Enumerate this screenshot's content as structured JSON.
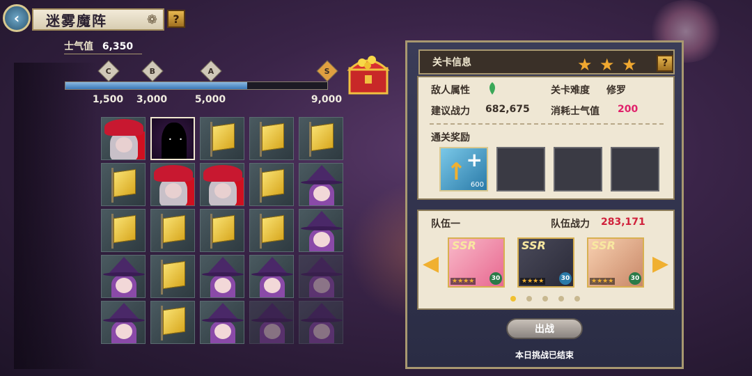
{
  "header": {
    "back_icon": "‹",
    "title": "迷雾魔阵",
    "title_deco": "❁",
    "help": "?"
  },
  "morale": {
    "label": "士气值",
    "value": "6,350",
    "progress_fraction": 0.6944
  },
  "grades": [
    "C",
    "B",
    "A",
    "S"
  ],
  "thresholds": [
    "1,500",
    "3,000",
    "5,000",
    "9,000"
  ],
  "grid": [
    [
      "red",
      "shadow",
      "flag",
      "flag",
      "flag"
    ],
    [
      "flag",
      "red",
      "red",
      "flag",
      "witch"
    ],
    [
      "flag",
      "flag",
      "flag",
      "flag",
      "witch"
    ],
    [
      "witch",
      "flag",
      "witch",
      "witch",
      "witch_faded"
    ],
    [
      "witch",
      "flag",
      "witch",
      "witch_faded",
      "witch_faded"
    ]
  ],
  "stage_info": {
    "title": "关卡信息",
    "stars": 3,
    "star_glyph": "★",
    "help": "?",
    "enemy_attr_label": "敌人属性",
    "difficulty_label": "关卡难度",
    "difficulty_value": "修罗",
    "power_label": "建议战力",
    "power_value": "682,675",
    "cost_label": "消耗士气值",
    "cost_value": "200"
  },
  "rewards": {
    "label": "通关奖励",
    "items": [
      {
        "count": "600",
        "arrow": "↑",
        "plus": "+"
      }
    ]
  },
  "team": {
    "name": "队伍一",
    "power_label": "队伍战力",
    "power_value": "283,171",
    "cards": [
      {
        "rarity": "SSR",
        "stars": "★★★★",
        "level": "30"
      },
      {
        "rarity": "SSR",
        "stars": "★★★★",
        "level": "30"
      },
      {
        "rarity": "SSR",
        "stars": "★★★★",
        "level": "30"
      }
    ],
    "page": 1,
    "page_count": 5
  },
  "actions": {
    "go_label": "出战",
    "status": "本日挑战已结束"
  },
  "colors": {
    "accent_pink": "#e0206a",
    "team_power": "#d0203a",
    "gold": "#f0b030"
  }
}
